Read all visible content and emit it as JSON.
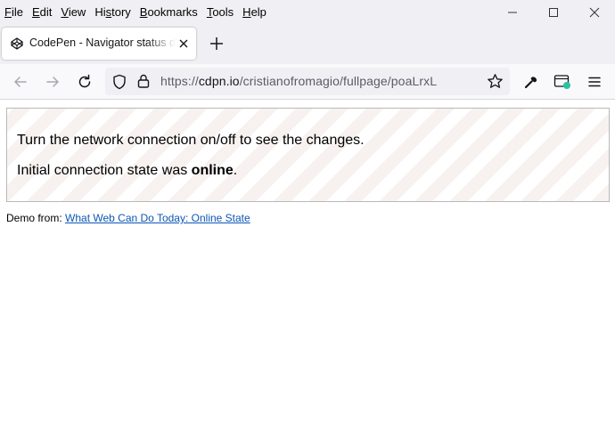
{
  "menubar": {
    "items": [
      "File",
      "Edit",
      "View",
      "History",
      "Bookmarks",
      "Tools",
      "Help"
    ]
  },
  "tab": {
    "title": "CodePen - Navigator status demo"
  },
  "url": {
    "scheme": "https://",
    "host": "cdpn.io",
    "path": "/cristianofromagio/fullpage/poaLrxL"
  },
  "page": {
    "instruction": "Turn the network connection on/off to see the changes.",
    "state_prefix": "Initial connection state was ",
    "state_value": "online",
    "state_suffix": ".",
    "demo_prefix": "Demo from: ",
    "demo_link": "What Web Can Do Today: Online State"
  },
  "colors": {
    "link": "#0b57b5",
    "stripe": "#f7f2f0"
  },
  "icons": [
    "codepen-icon",
    "close-icon",
    "plus-icon",
    "back-icon",
    "forward-icon",
    "reload-icon",
    "shield-icon",
    "lock-icon",
    "star-icon",
    "wrench-icon",
    "extension-icon",
    "menu-icon",
    "minimize-icon",
    "maximize-icon",
    "window-close-icon"
  ]
}
